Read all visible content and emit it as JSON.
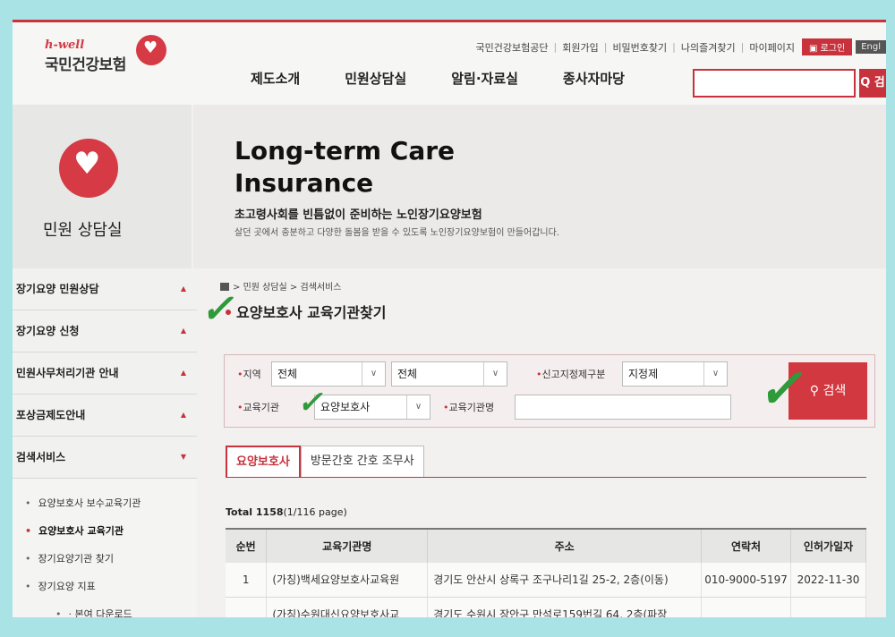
{
  "header": {
    "logo_sub": "h-well",
    "logo_main": "국민건강보험",
    "util_links": [
      "국민건강보험공단",
      "회원가입",
      "비밀번호찾기",
      "나의즐겨찾기",
      "마이페이지"
    ],
    "login_label": "로그인",
    "english_label": "Engl",
    "nav": [
      "제도소개",
      "민원상담실",
      "알림·자료실",
      "종사자마당"
    ],
    "search_button": "Q 검"
  },
  "left_visual": {
    "title": "민원 상담실"
  },
  "banner": {
    "title": "Long-term Care Insurance",
    "subtitle": "초고령사회를 빈틈없이 준비하는 노인장기요양보험",
    "description": "살던 곳에서 충분하고 다양한 돌봄을 받을 수 있도록 노인장기요양보험이 만들어갑니다."
  },
  "sidebar": {
    "items": [
      "장기요양 민원상담",
      "장기요양 신청",
      "민원사무처리기관 안내",
      "포상금제도안내",
      "검색서비스"
    ],
    "sub_items": [
      "요양보호사 보수교육기관",
      "요양보호사 교육기관",
      "장기요양기관 찾기",
      "장기요양 지표",
      "· 본여 다운로드"
    ]
  },
  "breadcrumb": [
    "민원 상담실",
    "검색서비스"
  ],
  "page_title": "요양보호사 교육기관찾기",
  "search": {
    "region_label": "지역",
    "region1_value": "전체",
    "region2_value": "전체",
    "designation_label": "신고지정제구분",
    "designation_value": "지정제",
    "type_label": "교육기관",
    "type_value": "요양보호사",
    "name_label": "교육기관명",
    "name_value": "",
    "button_label": "검색"
  },
  "tabs": [
    "요양보호사",
    "방문간호 간호 조무사"
  ],
  "total": {
    "label": "Total 1158",
    "pages": "(1/116 page)"
  },
  "table": {
    "headers": [
      "순번",
      "교육기관명",
      "주소",
      "연락처",
      "인허가일자"
    ],
    "rows": [
      [
        "1",
        "(가칭)백세요양보호사교육원",
        "경기도 안산시 상록구 조구나리1길 25-2, 2층(이동)",
        "010-9000-5197",
        "2022-11-30"
      ],
      [
        "",
        "(가칭)수원대신요양보호사교",
        "경기도 수원시 장안구 만석로159번길 64, 2층(파장",
        "",
        ""
      ]
    ]
  },
  "accent_color": "#c8323c"
}
